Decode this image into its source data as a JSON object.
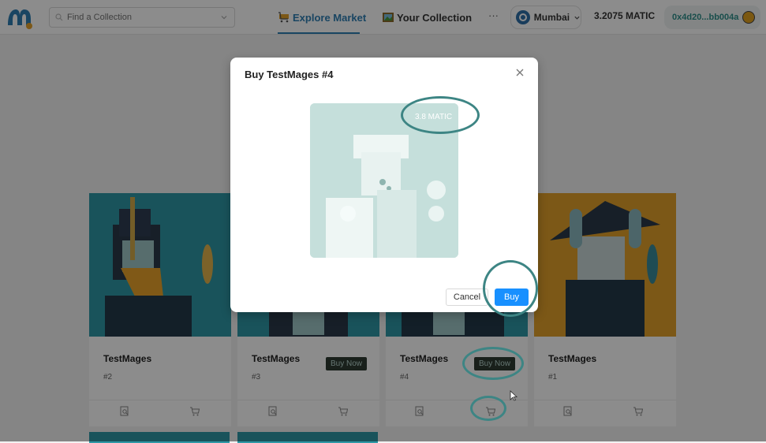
{
  "header": {
    "search_placeholder": "Find a Collection",
    "nav": {
      "explore": "Explore Market",
      "collection": "Your Collection",
      "more": "···"
    },
    "network": "Mumbai",
    "balance": "3.2075 MATIC",
    "account": "0x4d20...bb004a"
  },
  "cards": [
    {
      "name": "TestMages",
      "number": "#2"
    },
    {
      "name": "TestMages",
      "number": "#3",
      "buy_label": "Buy Now"
    },
    {
      "name": "TestMages",
      "number": "#4",
      "buy_label": "Buy Now"
    },
    {
      "name": "TestMages",
      "number": "#1"
    }
  ],
  "modal": {
    "title": "Buy TestMages #4",
    "price": "3.8 MATIC",
    "cancel_label": "Cancel",
    "buy_label": "Buy"
  },
  "colors": {
    "accent": "#2f7fb3",
    "buy_button": "#1890ff",
    "annotation": "#3d8584",
    "card_teal": "#2e98a6",
    "card_orange": "#e2a02a"
  },
  "icons": {
    "logo": "logo-icon",
    "search": "search-icon",
    "explore": "shopping-cart-icon",
    "collection": "picture-icon",
    "network": "polygon-icon",
    "card_view": "file-search-icon",
    "card_cart": "cart-icon",
    "close": "close-icon"
  }
}
